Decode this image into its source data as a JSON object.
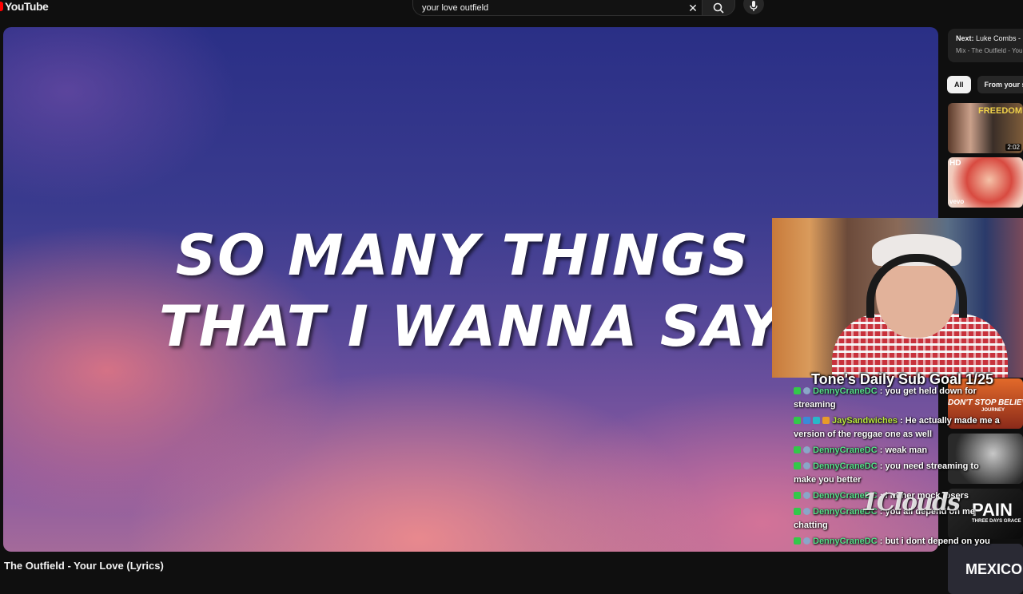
{
  "app": {
    "name": "YouTube"
  },
  "search": {
    "query": "your love outfield"
  },
  "video": {
    "lyric_line_1": "SO MANY THINGS",
    "lyric_line_2": "THAT I WANNA SAY",
    "title": "The Outfield - Your Love (Lyrics)"
  },
  "up_next": {
    "label": "Next:",
    "title": "Luke Combs -",
    "subtitle": "Mix - The Outfield - Your"
  },
  "chips": [
    {
      "label": "All",
      "active": true
    },
    {
      "label": "From your se",
      "active": false
    }
  ],
  "thumbnails": [
    {
      "text": "FREEDOM WRI",
      "badge": "2:02"
    },
    {
      "text": "HD",
      "sub": "vevo"
    },
    {
      "text": "DON'T STOP BELIEV",
      "sub": "JOURNEY"
    },
    {
      "text": ""
    },
    {
      "text": "PAIN",
      "sub": "THREE DAYS GRACE"
    },
    {
      "text": "MEXICO"
    }
  ],
  "stream": {
    "sub_goal": "Tone's Daily Sub Goal 1/25",
    "watermark": "1Clouds"
  },
  "chat": [
    {
      "user": "DennyCraneDC",
      "text": " : you get held down for streaming"
    },
    {
      "user": "JaySandwiches",
      "text": " : He actually made me a version of the reggae one as well"
    },
    {
      "user": "DennyCraneDC",
      "text": " : weak man"
    },
    {
      "user": "DennyCraneDC",
      "text": " : you need streaming to make you better"
    },
    {
      "user": "DennyCraneDC",
      "text": " : i rather mock losers"
    },
    {
      "user": "DennyCraneDC",
      "text": " : you all depend on me chatting"
    },
    {
      "user": "DennyCraneDC",
      "text": " : but i dont depend on you"
    }
  ],
  "colors": {
    "brand_red": "#ff0000",
    "chat_name_green": "#56e08a",
    "chat_name_lime": "#b8e63c"
  }
}
